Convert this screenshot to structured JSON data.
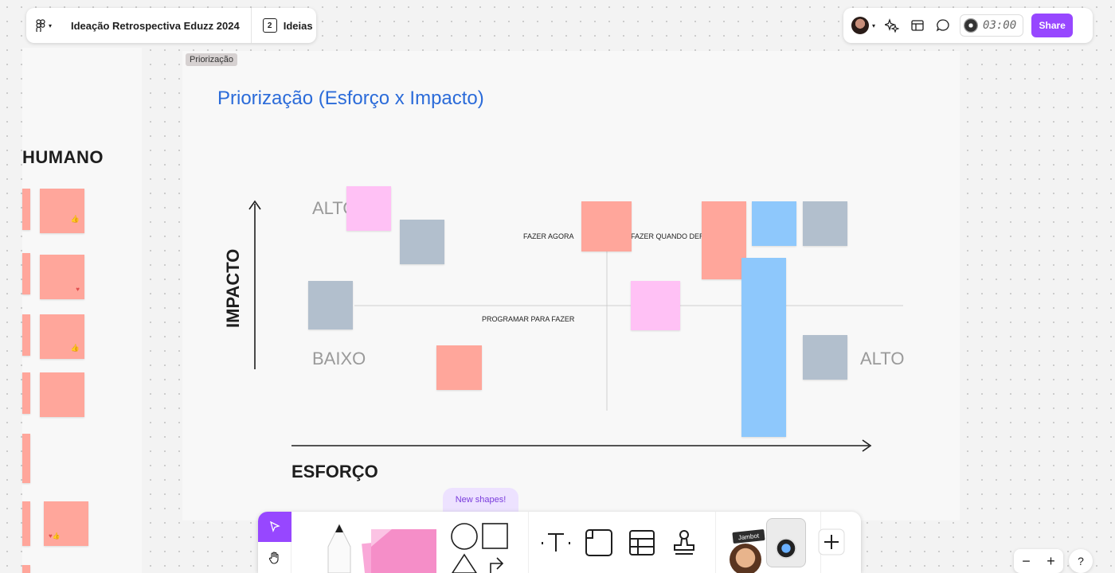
{
  "header": {
    "title": "Ideação Retrospectiva Eduzz 2024",
    "pages_count": "2",
    "pages_label": "Ideias",
    "timer": "03:00",
    "share_label": "Share"
  },
  "left_panel": {
    "section_title": "HUMANO"
  },
  "frame": {
    "label": "Priorização",
    "title": "Priorização (Esforço x Impacto)",
    "y_axis_title": "IMPACTO",
    "x_axis_title": "ESFORÇO",
    "impact_high": "ALTO",
    "impact_low": "BAIXO",
    "effort_high": "ALTO",
    "quadrants": {
      "do_now": "FAZER AGORA",
      "do_when_possible": "FAZER QUANDO DER",
      "schedule": "PROGRAMAR PARA FAZER"
    }
  },
  "toolbar": {
    "new_shapes_label": "New shapes!",
    "sticker_label": "Jambot"
  },
  "colors": {
    "accent": "#9747ff",
    "title_blue": "#2b6bd9",
    "sticky_salmon": "#ffa69b",
    "sticky_pink": "#ffc1f5",
    "sticky_blue": "#8ec8fc",
    "sticky_gray": "#b2bfcd"
  }
}
